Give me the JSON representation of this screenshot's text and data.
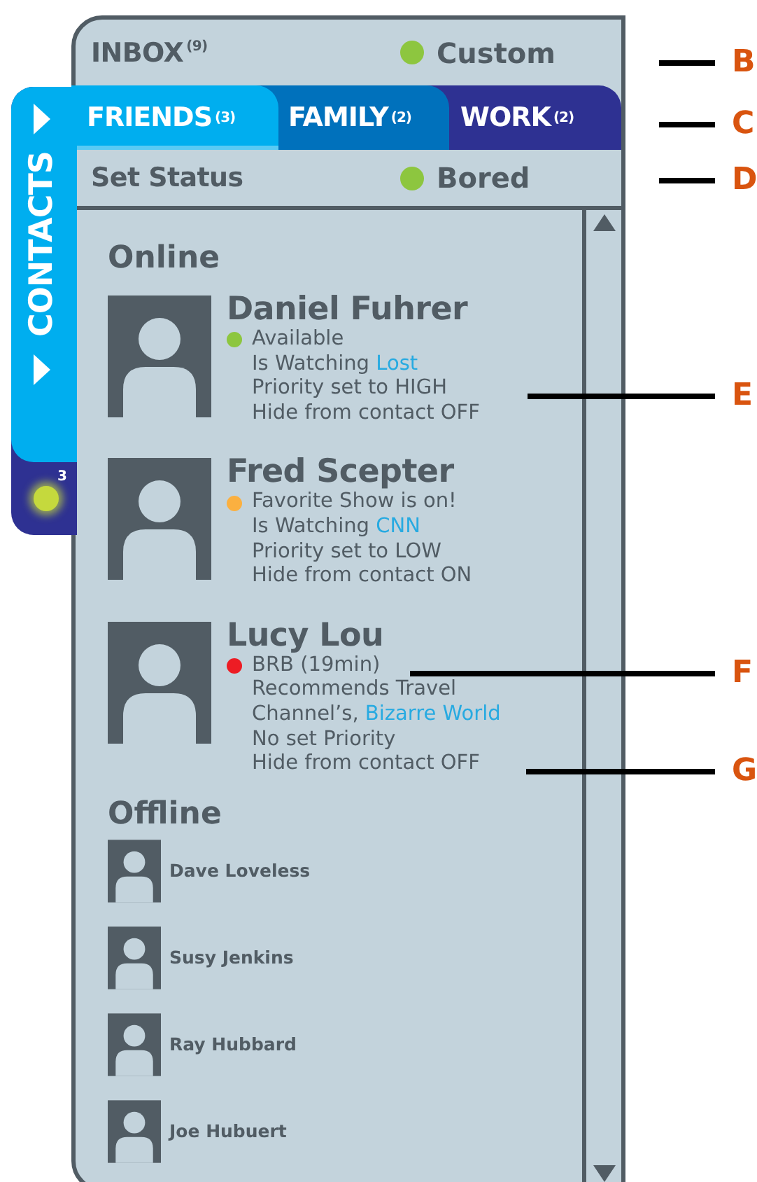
{
  "header": {
    "inbox": {
      "label": "INBOX",
      "count": "(9)"
    },
    "status": {
      "label": "Custom",
      "color": "#8dc63f"
    }
  },
  "tabs": [
    {
      "label": "FRIENDS",
      "count": "(3)",
      "selected": true,
      "color": "#00aeef"
    },
    {
      "label": "FAMILY",
      "count": "(2)",
      "selected": false,
      "color": "#0071bc"
    },
    {
      "label": "WORK",
      "count": "(2)",
      "selected": false,
      "color": "#2e3192"
    }
  ],
  "side_tab": {
    "label": "CONTACTS",
    "badge": "3"
  },
  "set_status": {
    "label": "Set Status",
    "value": "Bored",
    "color": "#8dc63f"
  },
  "online": {
    "heading": "Online",
    "contacts": [
      {
        "name": "Daniel Fuhrer",
        "status": "Available",
        "color": "#8dc63f",
        "lines": [
          {
            "text": "Is Watching",
            "link": "Lost"
          },
          {
            "text": "Priority set to HIGH"
          },
          {
            "text": "Hide from contact OFF"
          }
        ]
      },
      {
        "name": "Fred Scepter",
        "status": "Favorite Show is on!",
        "color": "#fbb040",
        "lines": [
          {
            "text": "Is Watching",
            "link": "CNN"
          },
          {
            "text": "Priority set to LOW"
          },
          {
            "text": "Hide from contact ON"
          }
        ]
      },
      {
        "name": "Lucy Lou",
        "status": "BRB (19min)",
        "color": "#ed1c24",
        "lines": [
          {
            "text": "Recommends Travel"
          },
          {
            "text": "Channel’s,",
            "link": "Bizarre World"
          },
          {
            "text": "No set Priority"
          },
          {
            "text": "Hide from contact OFF"
          }
        ]
      }
    ]
  },
  "offline": {
    "heading": "Offline",
    "contacts": [
      {
        "name": "Dave Loveless"
      },
      {
        "name": "Susy Jenkins"
      },
      {
        "name": "Ray Hubbard"
      },
      {
        "name": "Joe Hubuert"
      }
    ]
  },
  "callouts": [
    {
      "letter": "B"
    },
    {
      "letter": "C"
    },
    {
      "letter": "D"
    },
    {
      "letter": "E"
    },
    {
      "letter": "F"
    },
    {
      "letter": "G"
    }
  ]
}
